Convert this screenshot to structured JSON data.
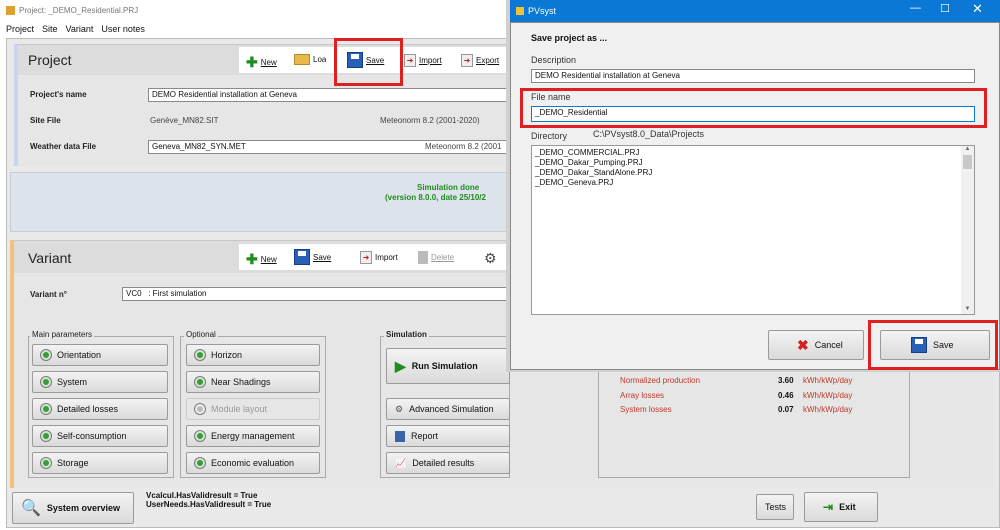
{
  "main_window": {
    "title": "Project: _DEMO_Residential.PRJ",
    "menu": [
      "Project",
      "Site",
      "Variant",
      "User notes"
    ]
  },
  "project": {
    "header": "Project",
    "toolbar": {
      "new": "New",
      "load": "Loa",
      "save": "Save",
      "import": "Import",
      "export": "Export"
    },
    "name_label": "Project's name",
    "name_value": "DEMO Residential installation at Geneva",
    "site_label": "Site File",
    "site_value": "Genève_MN82.SIT",
    "site_source": "Meteonorm 8.2 (2001-2020)",
    "weather_label": "Weather data File",
    "weather_value": "Geneva_MN82_SYN.MET",
    "weather_source": "Meteonorm 8.2 (2001"
  },
  "status": {
    "line1": "Simulation done",
    "line2": "(version 8.0.0, date 25/10/2"
  },
  "variant": {
    "header": "Variant",
    "toolbar": {
      "new": "New",
      "save": "Save",
      "import": "Import",
      "delete": "Delete"
    },
    "number_label": "Variant n°",
    "number_value": "VC0",
    "number_desc": ": First simulation"
  },
  "main_parameters": {
    "title": "Main parameters",
    "items": [
      "Orientation",
      "System",
      "Detailed losses",
      "Self-consumption",
      "Storage"
    ]
  },
  "optional": {
    "title": "Optional",
    "items": [
      "Horizon",
      "Near Shadings",
      "Module layout",
      "Energy management",
      "Economic evaluation"
    ]
  },
  "simulation": {
    "title": "Simulation",
    "run": "Run Simulation",
    "advanced": "Advanced Simulation",
    "report": "Report",
    "detailed": "Detailed results"
  },
  "results": [
    {
      "label": "Normalized production",
      "value": "3.60",
      "unit": "kWh/kWp/day"
    },
    {
      "label": "Array losses",
      "value": "0.46",
      "unit": "kWh/kWp/day"
    },
    {
      "label": "System losses",
      "value": "0.07",
      "unit": "kWh/kWp/day"
    }
  ],
  "bottom": {
    "system_overview": "System overview",
    "debug1": "Vcalcul.HasValidresult = True",
    "debug2": "UserNeeds.HasValidresult = True",
    "tests": "Tests",
    "exit": "Exit"
  },
  "dialog": {
    "title": "PVsyst",
    "heading": "Save project as ...",
    "description_label": "Description",
    "description_value": "DEMO Residential installation at Geneva",
    "filename_label": "File name",
    "filename_value": "_DEMO_Residential",
    "directory_label": "Directory",
    "directory_value": "C:\\PVsyst8.0_Data\\Projects",
    "files": [
      "_DEMO_COMMERCIAL.PRJ",
      "_DEMO_Dakar_Pumping.PRJ",
      "_DEMO_Dakar_StandAlone.PRJ",
      "_DEMO_Geneva.PRJ"
    ],
    "cancel": "Cancel",
    "save": "Save"
  },
  "colors": {
    "accent_blue": "#0a78d4",
    "highlight_red": "#e02020",
    "run_green": "#1e8c1e"
  }
}
